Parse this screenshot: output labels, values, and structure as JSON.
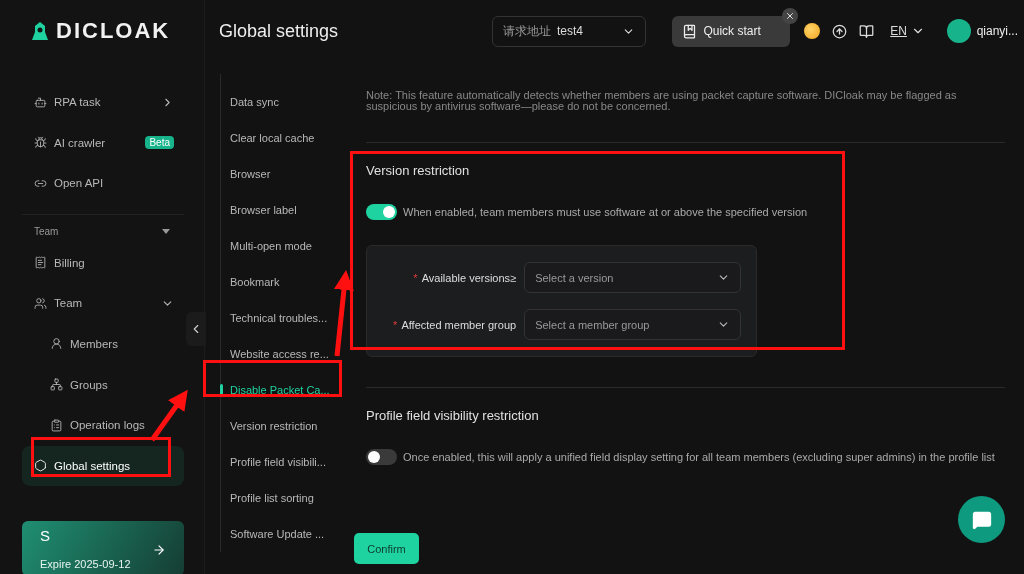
{
  "logo": {
    "text": "DICLOAK"
  },
  "sidebar": {
    "items": [
      {
        "label": "RPA task",
        "selected": false,
        "expanded": false
      },
      {
        "label": "AI crawler",
        "selected": false,
        "badge": "Beta"
      },
      {
        "label": "Open API",
        "selected": false
      }
    ],
    "team_section": {
      "label": "Team",
      "expanded": true,
      "items": [
        {
          "label": "Billing",
          "selected": false
        },
        {
          "label": "Team",
          "selected": false,
          "expanded": true,
          "children": [
            {
              "label": "Members",
              "selected": false
            },
            {
              "label": "Groups",
              "selected": false
            },
            {
              "label": "Operation logs",
              "selected": false
            }
          ]
        },
        {
          "label": "Global settings",
          "selected": true
        }
      ]
    },
    "plan": {
      "letter": "S",
      "expiry": "Expire 2025-09-12"
    }
  },
  "header": {
    "title": "Global settings",
    "address": {
      "label": "请求地址",
      "value": "test4"
    },
    "quick_start": "Quick start",
    "language": "EN",
    "user": "qianyi..."
  },
  "subnav": [
    {
      "label": "Data sync",
      "selected": false
    },
    {
      "label": "Clear local cache",
      "selected": false
    },
    {
      "label": "Browser",
      "selected": false
    },
    {
      "label": "Browser label",
      "selected": false
    },
    {
      "label": "Multi-open mode",
      "selected": false
    },
    {
      "label": "Bookmark",
      "selected": false
    },
    {
      "label": "Technical troubles...",
      "selected": false
    },
    {
      "label": "Website access re...",
      "selected": false
    },
    {
      "label": "Disable Packet Ca...",
      "selected": true
    },
    {
      "label": "Version restriction",
      "selected": false
    },
    {
      "label": "Profile field visibili...",
      "selected": false
    },
    {
      "label": "Profile list sorting",
      "selected": false
    },
    {
      "label": "Software Update ...",
      "selected": false
    }
  ],
  "content": {
    "note": "Note: This feature automatically detects whether members are using packet capture software. DICloak may be flagged as suspicious by antivirus software—please do not be concerned.",
    "sections": [
      {
        "title": "Version restriction",
        "on": true,
        "description": "When enabled, team members must use software at or above the specified version",
        "fields": [
          {
            "label": "Available versions≥",
            "required_mark": "*",
            "placeholder": "Select a version"
          },
          {
            "label": "Affected member group",
            "required_mark": "*",
            "placeholder": "Select a member group"
          }
        ]
      },
      {
        "title": "Profile field visibility restriction",
        "on": false,
        "description": "Once enabled, this will apply a unified field display setting for all team members (excluding super admins) in the profile list"
      }
    ],
    "confirm": "Confirm"
  }
}
